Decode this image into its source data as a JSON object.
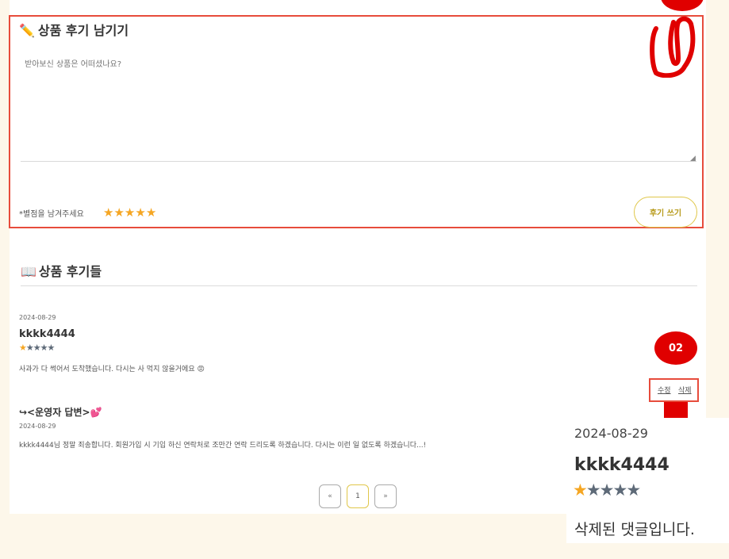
{
  "write_review": {
    "icon": "pencil-icon",
    "title": "상품 후기 남기기",
    "placeholder": "받아보신 상품은 어떠셨나요?",
    "rating_label": "*별점을 남겨주세요",
    "rating_value": 5,
    "rating_max": 5,
    "submit_label": "후기 쓰기"
  },
  "annotations": {
    "marker_1": "①",
    "marker_2": "02",
    "highlight_color": "#e74c3c",
    "marker_color": "#e00000"
  },
  "reviews_section": {
    "icon": "book-icon",
    "title": "상품 후기들",
    "reviews": [
      {
        "date": "2024-08-29",
        "user": "kkkk4444",
        "rating": 1,
        "rating_max": 5,
        "content": "사과가 다 썩어서 도착했습니다. 다시는 사 먹지 않을거에요 😡",
        "edit_label": "수정",
        "delete_label": "삭제"
      }
    ],
    "reply": {
      "title": "↪<운영자 답변>",
      "heart": "💕",
      "date": "2024-08-29",
      "content": "kkkk4444님 정말 죄송합니다. 회원가입 시 기입 하신 연락처로 조만간 연락 드리도록 하겠습니다. 다시는 이런 일 없도록 하겠습니다...!"
    }
  },
  "pagination": {
    "prev": "«",
    "current": "1",
    "next": "»"
  },
  "zoom_result": {
    "date": "2024-08-29",
    "user": "kkkk4444",
    "rating": 1,
    "rating_max": 5,
    "content": "삭제된 댓글입니다."
  },
  "colors": {
    "background": "#fdf7ea",
    "star_active": "#f5a623",
    "star_inactive": "#5e6a78",
    "button_border": "#e0c74a"
  }
}
